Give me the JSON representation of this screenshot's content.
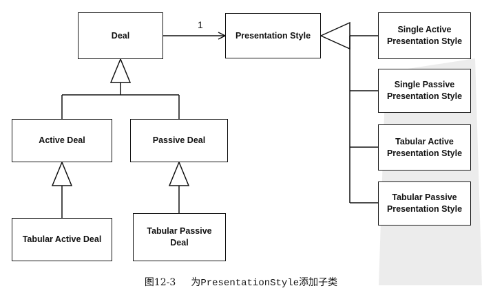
{
  "diagram": {
    "classes": {
      "deal": "Deal",
      "presentation_style": "Presentation Style",
      "active_deal": "Active Deal",
      "passive_deal": "Passive Deal",
      "tabular_active_deal": "Tabular Active Deal",
      "tabular_passive_deal": "Tabular Passive\nDeal",
      "single_active_presentation_style": "Single Active\nPresentation Style",
      "single_passive_presentation_style": "Single Passive\nPresentation Style",
      "tabular_active_presentation_style": "Tabular Active\nPresentation Style",
      "tabular_passive_presentation_style": "Tabular Passive\nPresentation Style"
    },
    "association_multiplicity": "1"
  },
  "caption": {
    "figure_number": "图12-3",
    "prefix": "为",
    "code": "PresentationStyle",
    "suffix": "添加子类"
  }
}
